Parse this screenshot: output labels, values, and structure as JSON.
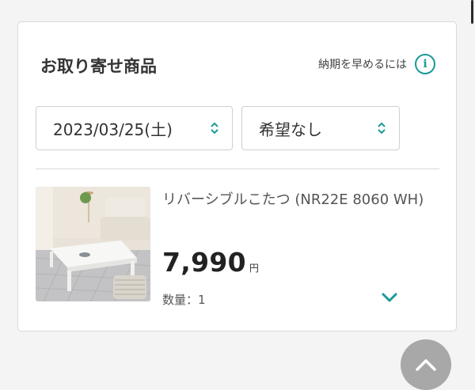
{
  "section": {
    "title": "お取り寄せ商品",
    "speed_link_text": "納期を早めるには",
    "info_icon_glyph": "i"
  },
  "delivery": {
    "date_selected": "2023/03/25(土)",
    "time_selected": "希望なし"
  },
  "product": {
    "name": "リバーシブルこたつ (NR22E 8060 WH)",
    "price": "7,990",
    "price_unit": "円",
    "quantity_text": "数量：1",
    "thumbnail_icon": "kotatsu-table-photo"
  },
  "colors": {
    "accent": "#1a9a96",
    "fab": "#a8a8a8"
  }
}
